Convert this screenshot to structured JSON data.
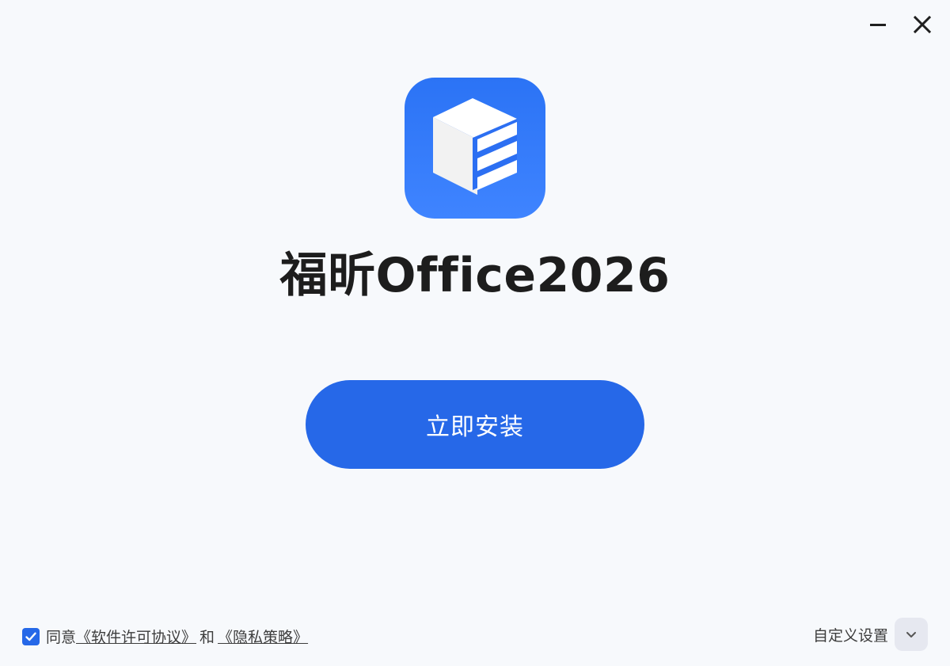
{
  "window": {
    "minimize_icon": "minimize-icon",
    "close_icon": "close-icon"
  },
  "app": {
    "title": "福昕Office2026",
    "logo_icon": "foxit-cube-logo-icon",
    "brand_color": "#2b73f5"
  },
  "install": {
    "label": "立即安装",
    "color": "#2668e8"
  },
  "agreement": {
    "checked": true,
    "prefix": "同意",
    "license_link": "《软件许可协议》",
    "conjunction": "和",
    "privacy_link": "《隐私策略》"
  },
  "custom_settings": {
    "label": "自定义设置",
    "toggle_icon": "chevron-down-icon"
  }
}
